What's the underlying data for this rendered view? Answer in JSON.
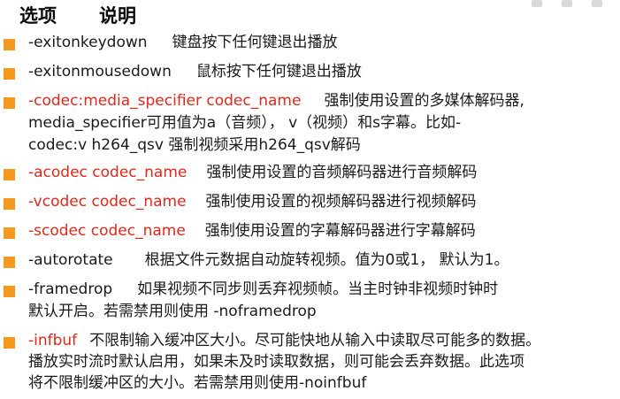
{
  "header": {
    "col_option": "选项",
    "col_desc": "说明"
  },
  "items": [
    {
      "option": "-exitonkeydown",
      "lines": [
        "键盘按下任何键退出播放"
      ]
    },
    {
      "option": "-exitonmousedown",
      "lines": [
        "鼠标按下任何键退出播放"
      ]
    },
    {
      "option": "-codec:media_specifier codec_name",
      "lines": [
        "强制使用设置的多媒体解码器,",
        "media_specifier可用值为a（音频）， v（视频）和s字幕。比如-",
        "codec:v h264_qsv 强制视频采用h264_qsv解码"
      ]
    },
    {
      "option": "-acodec codec_name",
      "lines": [
        "强制使用设置的音频解码器进行音频解码"
      ]
    },
    {
      "option": "-vcodec codec_name",
      "lines": [
        "强制使用设置的视频解码器进行视频解码"
      ]
    },
    {
      "option": "-scodec codec_name",
      "lines": [
        "强制使用设置的字幕解码器进行字幕解码"
      ]
    },
    {
      "option": "-autorotate",
      "lines": [
        "根据文件元数据自动旋转视频。值为0或1， 默认为1。"
      ]
    },
    {
      "option": "-framedrop",
      "lines": [
        "如果视频不同步则丢弃视频帧。当主时钟非视频时钟时",
        "默认开启。若需禁用则使用 -noframedrop"
      ]
    },
    {
      "option": "-infbuf",
      "lines": [
        "不限制输入缓冲区大小。尽可能快地从输入中读取尽可能多的数据。",
        "播放实时流时默认启用，如果未及时读取数据，则可能会丢弃数据。此选项",
        "将不限制缓冲区的大小。若需禁用则使用-noinfbuf"
      ]
    }
  ],
  "colors": {
    "bullet": "#f39a1e",
    "option_red": "#e0281c",
    "text": "#1a1a1a"
  }
}
